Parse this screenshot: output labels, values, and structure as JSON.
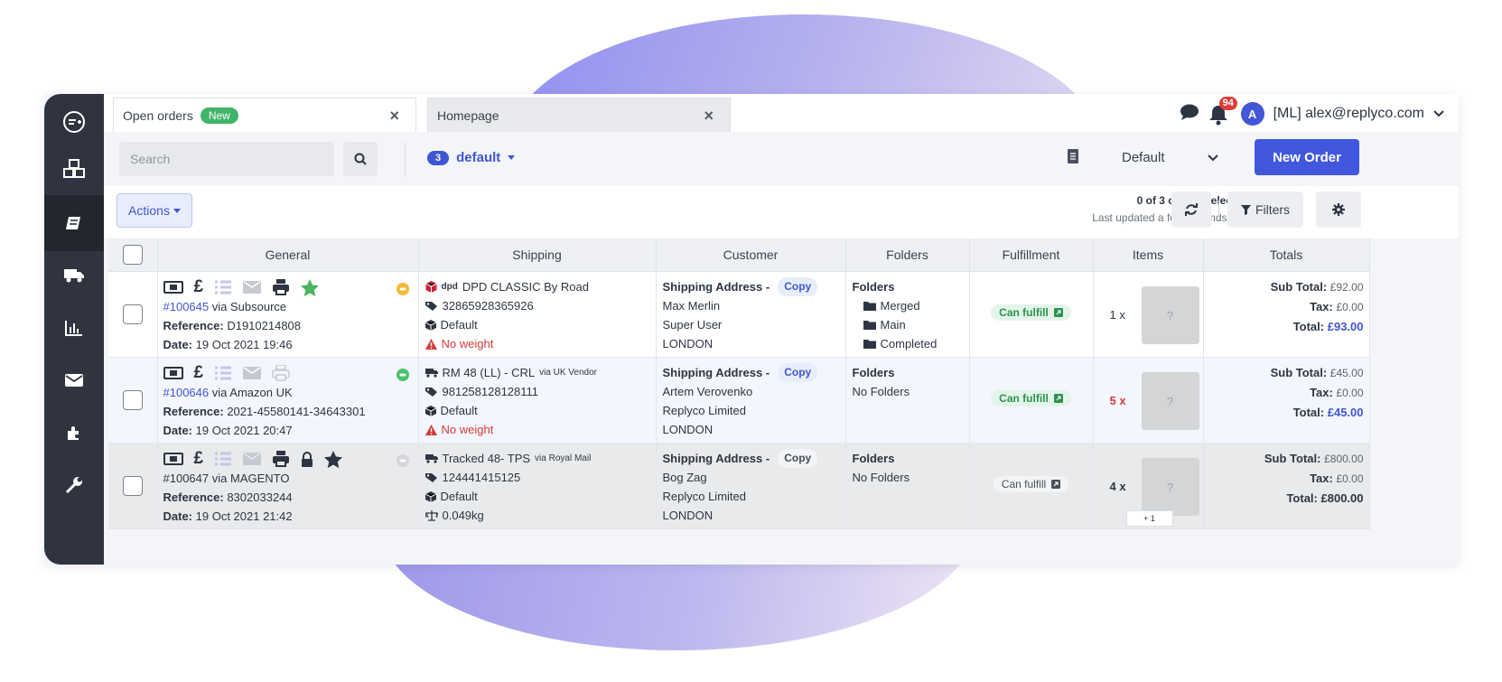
{
  "app": {
    "tabs": [
      {
        "label": "Open orders",
        "badge": "New"
      },
      {
        "label": "Homepage"
      }
    ],
    "tab_close_glyph": "×",
    "notifications_count": "94",
    "avatar_letter": "A",
    "user_label": "[ML] alex@replyco.com",
    "icons": [
      "logo-icon",
      "products-icon",
      "orders-icon",
      "shipping-icon",
      "reports-icon",
      "messages-icon",
      "integrations-icon",
      "tools-icon",
      "chat-icon",
      "bell-icon",
      "chevron-down-icon",
      "search-icon",
      "document-icon",
      "refresh-icon",
      "filter-icon",
      "gear-icon"
    ]
  },
  "toolbar": {
    "search_placeholder": "Search",
    "view_count": "3",
    "view_name": "default",
    "default_select": "Default",
    "new_order_label": "New Order"
  },
  "actionbar": {
    "actions_label": "Actions",
    "selected": "0 of 3 orders selected",
    "updated": "Last updated a few seconds ago",
    "filters_label": "Filters"
  },
  "table": {
    "headers": [
      "General",
      "Shipping",
      "Customer",
      "Folders",
      "Fulfillment",
      "Items",
      "Totals"
    ],
    "labels": {
      "via": "via",
      "reference": "Reference:",
      "date": "Date:",
      "shipping_address": "Shipping Address -",
      "copy": "Copy",
      "folders": "Folders",
      "sub_total": "Sub Total:",
      "tax": "Tax:",
      "total": "Total:"
    },
    "rows": [
      {
        "order_number": "#100645",
        "channel": "Subsource",
        "reference": "D1910214808",
        "date": "19 Oct 2021 19:46",
        "carrier_logo": "dpd",
        "carrier": "DPD CLASSIC By Road",
        "carrier_via": "",
        "tracking": "32865928365926",
        "package": "Default",
        "weight": "No weight",
        "customer_name": "Max Merlin",
        "customer_company": "Super User",
        "customer_city": "LONDON",
        "folders": [
          "Merged",
          "Main",
          "Completed"
        ],
        "fulfillment": "Can fulfill",
        "qty": "1 x",
        "thumb": "?",
        "sub_total": "£92.00",
        "tax": "£0.00",
        "total": "£93.00"
      },
      {
        "order_number": "#100646",
        "channel": "Amazon UK",
        "reference": "2021-45580141-34643301",
        "date": "19 Oct 2021 20:47",
        "carrier": "RM 48 (LL) - CRL",
        "carrier_via": "via UK Vendor",
        "tracking": "981258128128111",
        "package": "Default",
        "weight": "No weight",
        "customer_name": "Artem Verovenko",
        "customer_company": "Replyco Limited",
        "customer_city": "LONDON",
        "folders_text": "No Folders",
        "fulfillment": "Can fulfill",
        "qty": "5 x",
        "thumb": "?",
        "sub_total": "£45.00",
        "tax": "£0.00",
        "total": "£45.00"
      },
      {
        "order_number": "#100647",
        "channel": "MAGENTO",
        "reference": "8302033244",
        "date": "19 Oct 2021 21:42",
        "carrier": "Tracked 48- TPS",
        "carrier_via": "via Royal Mail",
        "tracking": "124441415125",
        "package": "Default",
        "weight": "0.049kg",
        "customer_name": "Bog Zag",
        "customer_company": "Replyco Limited",
        "customer_city": "LONDON",
        "folders_text": "No Folders",
        "fulfillment": "Can fulfill",
        "qty": "4 x",
        "thumb": "?",
        "more_items": "+ 1",
        "sub_total": "£800.00",
        "tax": "£0.00",
        "total": "£800.00"
      }
    ]
  },
  "colors": {
    "accent": "#4157de",
    "sidebar": "#2f3440",
    "success": "#41b46a",
    "danger": "#e23b3b"
  }
}
